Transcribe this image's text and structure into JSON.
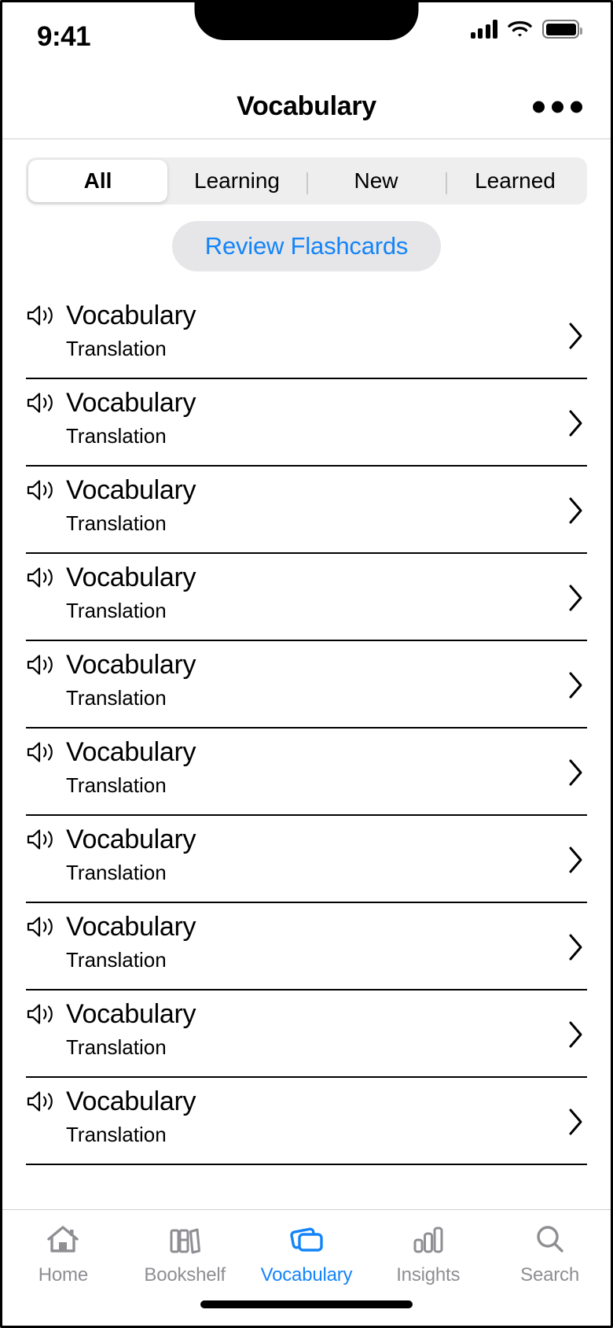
{
  "status_bar": {
    "time": "9:41",
    "cellular_icon": "cellular-signal-icon",
    "wifi_icon": "wifi-icon",
    "battery_icon": "battery-icon"
  },
  "nav_bar": {
    "title": "Vocabulary",
    "more_icon": "more-options-icon"
  },
  "filters": {
    "segments": [
      {
        "label": "All",
        "active": true
      },
      {
        "label": "Learning",
        "active": false
      },
      {
        "label": "New",
        "active": false
      },
      {
        "label": "Learned",
        "active": false
      }
    ]
  },
  "review": {
    "label": "Review Flashcards",
    "accent_color": "#1484f8",
    "background_color": "#e6e6e8"
  },
  "list": {
    "items": [
      {
        "word": "Vocabulary",
        "translation": "Translation",
        "speaker_icon": "speaker-icon",
        "chevron_icon": "chevron-right-icon"
      },
      {
        "word": "Vocabulary",
        "translation": "Translation",
        "speaker_icon": "speaker-icon",
        "chevron_icon": "chevron-right-icon"
      },
      {
        "word": "Vocabulary",
        "translation": "Translation",
        "speaker_icon": "speaker-icon",
        "chevron_icon": "chevron-right-icon"
      },
      {
        "word": "Vocabulary",
        "translation": "Translation",
        "speaker_icon": "speaker-icon",
        "chevron_icon": "chevron-right-icon"
      },
      {
        "word": "Vocabulary",
        "translation": "Translation",
        "speaker_icon": "speaker-icon",
        "chevron_icon": "chevron-right-icon"
      },
      {
        "word": "Vocabulary",
        "translation": "Translation",
        "speaker_icon": "speaker-icon",
        "chevron_icon": "chevron-right-icon"
      },
      {
        "word": "Vocabulary",
        "translation": "Translation",
        "speaker_icon": "speaker-icon",
        "chevron_icon": "chevron-right-icon"
      },
      {
        "word": "Vocabulary",
        "translation": "Translation",
        "speaker_icon": "speaker-icon",
        "chevron_icon": "chevron-right-icon"
      },
      {
        "word": "Vocabulary",
        "translation": "Translation",
        "speaker_icon": "speaker-icon",
        "chevron_icon": "chevron-right-icon"
      },
      {
        "word": "Vocabulary",
        "translation": "Translation",
        "speaker_icon": "speaker-icon",
        "chevron_icon": "chevron-right-icon"
      }
    ]
  },
  "tab_bar": {
    "active_color": "#1484f8",
    "inactive_color": "#8e8e93",
    "tabs": [
      {
        "label": "Home",
        "icon": "home-icon",
        "active": false
      },
      {
        "label": "Bookshelf",
        "icon": "bookshelf-icon",
        "active": false
      },
      {
        "label": "Vocabulary",
        "icon": "flashcards-icon",
        "active": true
      },
      {
        "label": "Insights",
        "icon": "bar-chart-icon",
        "active": false
      },
      {
        "label": "Search",
        "icon": "search-icon",
        "active": false
      }
    ]
  }
}
